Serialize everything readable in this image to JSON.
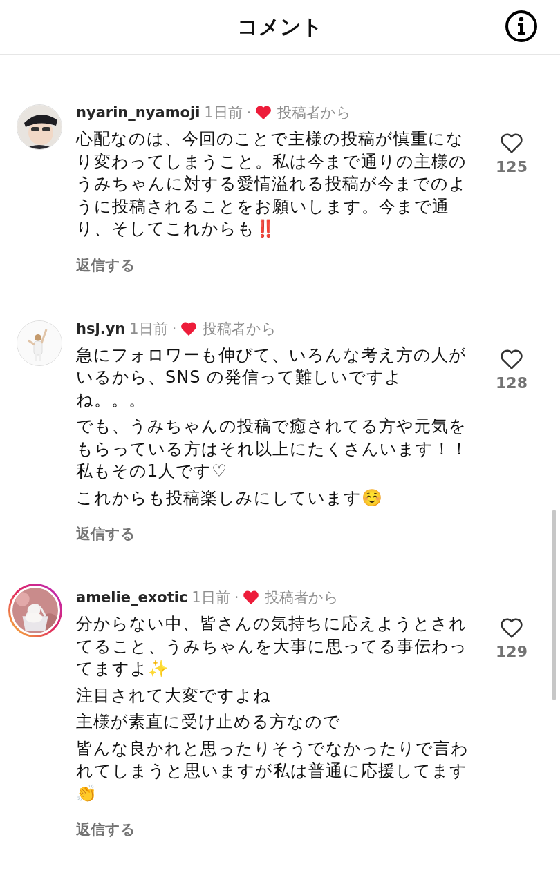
{
  "header": {
    "title": "コメント"
  },
  "separator": "·",
  "comments": [
    {
      "username": "nyarin_nyamoji",
      "time": "1日前",
      "liked_by_author": true,
      "author_label": "投稿者から",
      "story_ring": false,
      "avatar": {
        "kind": "picture"
      },
      "paragraphs": [
        "心配なのは、今回のことで主様の投稿が慎重になり変わってしまうこと。私は今まで通りの主様のうみちゃんに対する愛情溢れる投稿が今までのように投稿されることをお願いします。今まで通り、そしてこれからも‼️"
      ],
      "likes": "125",
      "reply": "返信する"
    },
    {
      "username": "hsj.yn",
      "time": "1日前",
      "liked_by_author": true,
      "author_label": "投稿者から",
      "story_ring": false,
      "avatar": {
        "kind": "picture"
      },
      "paragraphs": [
        "急にフォロワーも伸びて、いろんな考え方の人がいるから、SNS の発信って難しいですよね。。。",
        "でも、うみちゃんの投稿で癒されてる方や元気をもらっている方はそれ以上にたくさんいます！！私もその1人です♡",
        "これからも投稿楽しみにしています☺️"
      ],
      "likes": "128",
      "reply": "返信する"
    },
    {
      "username": "amelie_exotic",
      "time": "1日前",
      "liked_by_author": true,
      "author_label": "投稿者から",
      "story_ring": true,
      "avatar": {
        "kind": "picture"
      },
      "paragraphs": [
        "分からない中、皆さんの気持ちに応えようとされてること、うみちゃんを大事に思ってる事伝わってますよ✨",
        "注目されて大変ですよね",
        "主様が素直に受け止める方なので",
        "皆んな良かれと思ったりそうでなかったりで言われてしまうと思いますが私は普通に応援してます👏"
      ],
      "likes": "129",
      "reply": "返信する"
    }
  ]
}
